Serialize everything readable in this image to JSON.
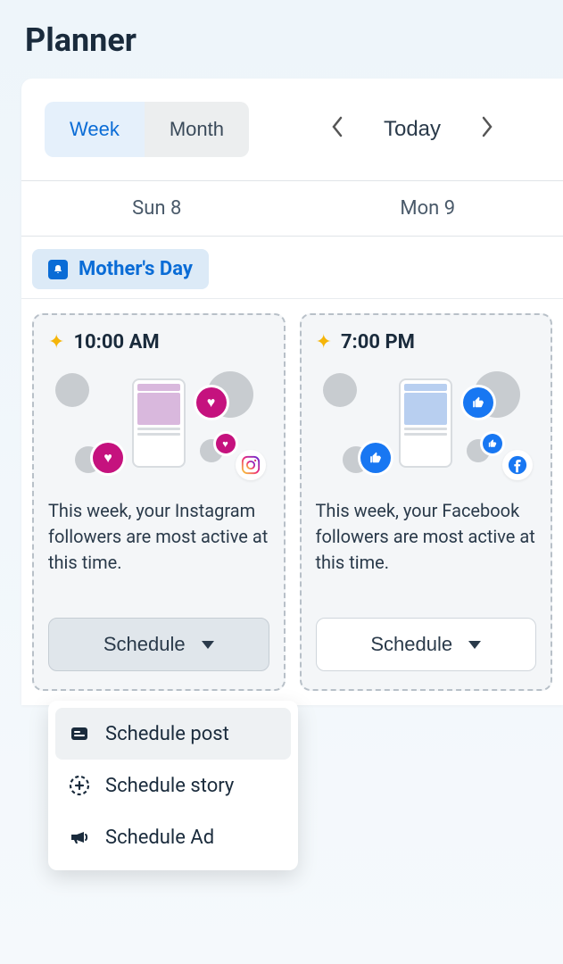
{
  "page": {
    "title": "Planner"
  },
  "view_toggle": {
    "week": "Week",
    "month": "Month",
    "active": "week"
  },
  "nav": {
    "today": "Today"
  },
  "days": [
    {
      "label": "Sun 8"
    },
    {
      "label": "Mon 9"
    }
  ],
  "event": {
    "name": "Mother's Day",
    "icon": "bell-icon"
  },
  "cards": [
    {
      "time": "10:00 AM",
      "platform": "instagram",
      "text": "This week, your Instagram followers are most active at this time.",
      "button": "Schedule",
      "button_open": true
    },
    {
      "time": "7:00 PM",
      "platform": "facebook",
      "text": "This week, your Facebook followers are most active at this time.",
      "button": "Schedule",
      "button_open": false
    }
  ],
  "dropdown": {
    "items": [
      {
        "icon": "post-icon",
        "label": "Schedule post",
        "hover": true
      },
      {
        "icon": "story-icon",
        "label": "Schedule story",
        "hover": false
      },
      {
        "icon": "ad-icon",
        "label": "Schedule Ad",
        "hover": false
      }
    ]
  },
  "colors": {
    "accent": "#0a6cd6",
    "instagram": "#c5127e",
    "facebook": "#1877f2",
    "star": "#f5b50a"
  }
}
